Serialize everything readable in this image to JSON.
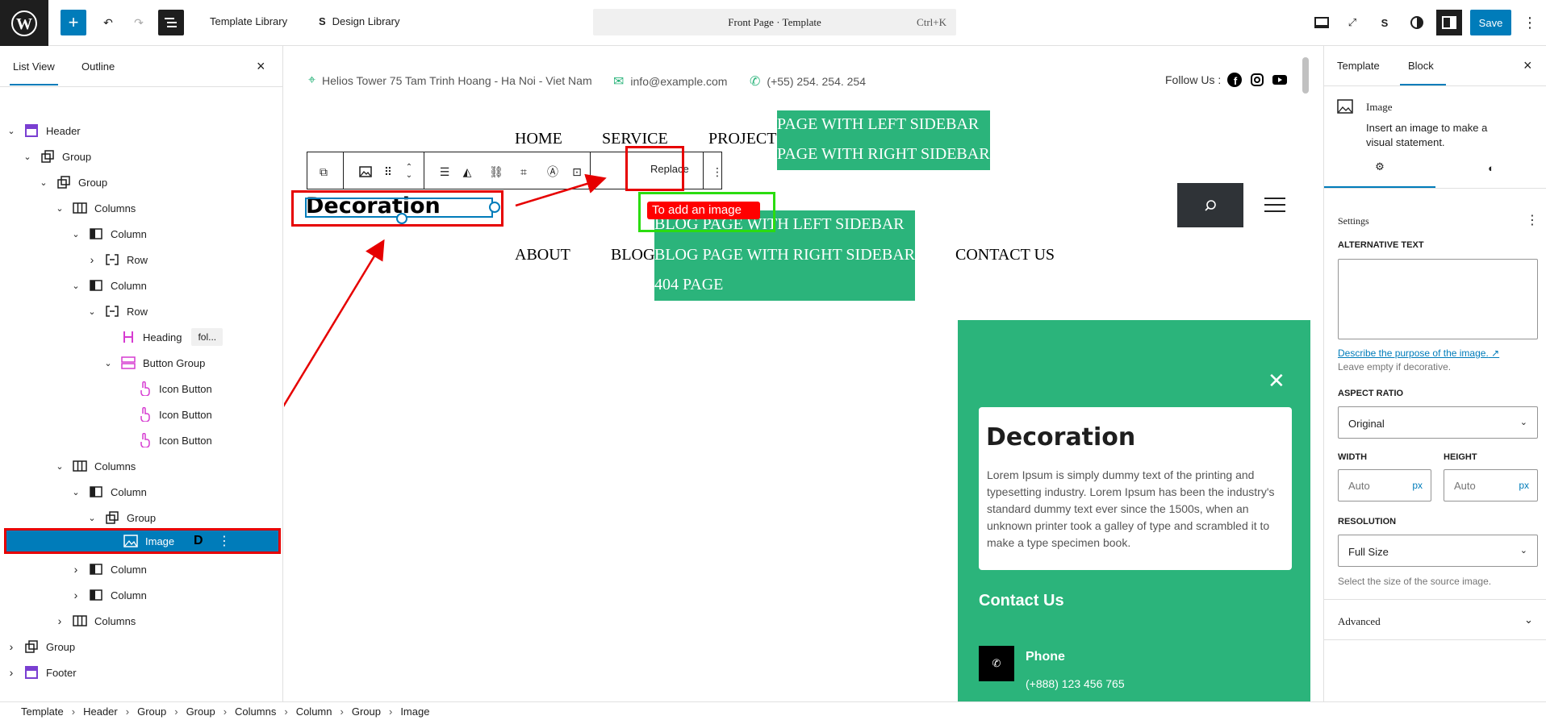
{
  "topbar": {
    "template_library": "Template Library",
    "design_library": "Design Library",
    "command_title": "Front Page · Template",
    "command_shortcut": "Ctrl+K",
    "save": "Save"
  },
  "list_view": {
    "tab_list": "List View",
    "tab_outline": "Outline",
    "items": [
      {
        "label": "Header",
        "depth": 0,
        "open": true,
        "icon": "template-part-icon"
      },
      {
        "label": "Group",
        "depth": 1,
        "open": true,
        "icon": "group-icon"
      },
      {
        "label": "Group",
        "depth": 2,
        "open": true,
        "icon": "group-icon"
      },
      {
        "label": "Columns",
        "depth": 3,
        "open": true,
        "icon": "columns-icon"
      },
      {
        "label": "Column",
        "depth": 4,
        "open": true,
        "icon": "column-icon"
      },
      {
        "label": "Row",
        "depth": 5,
        "open": false,
        "icon": "row-icon"
      },
      {
        "label": "Column",
        "depth": 4,
        "open": true,
        "icon": "column-icon"
      },
      {
        "label": "Row",
        "depth": 5,
        "open": true,
        "icon": "row-icon"
      },
      {
        "label": "Heading",
        "depth": 6,
        "icon": "heading-icon",
        "chip": "fol..."
      },
      {
        "label": "Button Group",
        "depth": 6,
        "open": true,
        "icon": "button-group-icon"
      },
      {
        "label": "Icon Button",
        "depth": 7,
        "icon": "icon-button-icon"
      },
      {
        "label": "Icon Button",
        "depth": 7,
        "icon": "icon-button-icon"
      },
      {
        "label": "Icon Button",
        "depth": 7,
        "icon": "icon-button-icon"
      },
      {
        "label": "Columns",
        "depth": 3,
        "open": true,
        "icon": "columns-icon"
      },
      {
        "label": "Column",
        "depth": 4,
        "open": true,
        "icon": "column-icon"
      },
      {
        "label": "Group",
        "depth": 5,
        "open": true,
        "icon": "group-icon"
      },
      {
        "label": "Image",
        "depth": 6,
        "icon": "image-icon",
        "selected": true,
        "chip": "D"
      },
      {
        "label": "Column",
        "depth": 4,
        "open": false,
        "icon": "column-icon"
      },
      {
        "label": "Column",
        "depth": 4,
        "open": false,
        "icon": "column-icon"
      },
      {
        "label": "Columns",
        "depth": 3,
        "open": false,
        "icon": "columns-icon"
      },
      {
        "label": "Group",
        "depth": 0,
        "open": false,
        "icon": "group-icon"
      },
      {
        "label": "Footer",
        "depth": 0,
        "open": false,
        "icon": "template-part-icon"
      }
    ]
  },
  "canvas": {
    "address": "Helios Tower 75 Tam Trinh Hoang - Ha Noi - Viet Nam",
    "email": "info@example.com",
    "phone": "(+55) 254. 254. 254",
    "follow": "Follow Us :",
    "nav": [
      "HOME",
      "SERVICE",
      "PROJECT",
      "ABOUT",
      "BLOG",
      "CONTACT US"
    ],
    "submenu_project": [
      "PAGE WITH LEFT SIDEBAR",
      "PAGE WITH RIGHT SIDEBAR"
    ],
    "submenu_blog": [
      "BLOG PAGE WITH LEFT SIDEBAR",
      "BLOG PAGE WITH RIGHT SIDEBAR",
      "404 PAGE"
    ],
    "replace": "Replace",
    "image_alt_text": "Decoration",
    "tooltip": "To add an image",
    "panel": {
      "card_title": "Decoration",
      "card_text": "Lorem Ipsum is simply dummy text of the printing and typesetting industry. Lorem Ipsum has been the industry's standard dummy text ever since the 1500s, when an unknown printer took a galley of type and scrambled it to make a type specimen book.",
      "contact_title": "Contact Us",
      "phone_label": "Phone",
      "phone_value": "(+888) 123 456 765"
    },
    "accent": "#2bb47b"
  },
  "inspector": {
    "tab_template": "Template",
    "tab_block": "Block",
    "block_name": "Image",
    "block_desc": "Insert an image to make a visual statement.",
    "settings": "Settings",
    "alt_label": "ALTERNATIVE TEXT",
    "alt_link": "Describe the purpose of the image.",
    "alt_help": "Leave empty if decorative.",
    "aspect_label": "ASPECT RATIO",
    "aspect_value": "Original",
    "width_label": "WIDTH",
    "height_label": "HEIGHT",
    "auto": "Auto",
    "px": "px",
    "resolution_label": "RESOLUTION",
    "resolution_value": "Full Size",
    "resolution_help": "Select the size of the source image.",
    "advanced": "Advanced"
  },
  "breadcrumb": [
    "Template",
    "Header",
    "Group",
    "Group",
    "Columns",
    "Column",
    "Group",
    "Image"
  ]
}
